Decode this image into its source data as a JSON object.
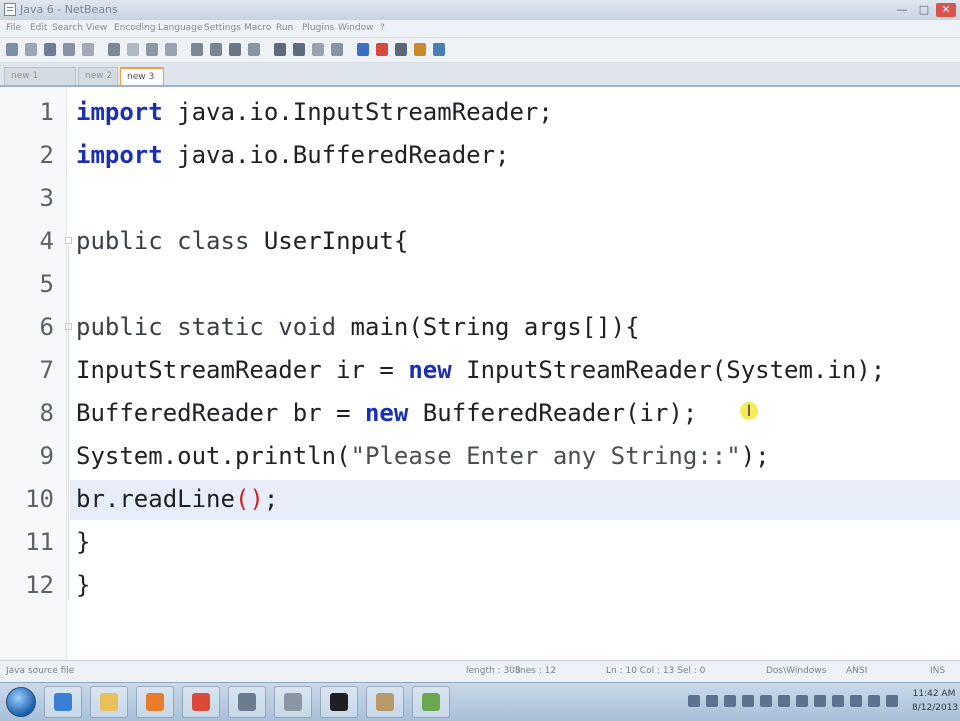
{
  "window": {
    "title": "Java 6 - NetBeans",
    "controls": {
      "minimize": "—",
      "maximize": "□",
      "close": "✕"
    }
  },
  "menu": {
    "items": [
      "File",
      "Edit",
      "Search",
      "View",
      "Encoding",
      "Language",
      "Settings",
      "Macro",
      "Run",
      "Plugins",
      "Window",
      "?"
    ]
  },
  "toolbar": {
    "icons": [
      "new-file-icon",
      "open-file-icon",
      "save-icon",
      "save-all-icon",
      "close-icon",
      "print-icon",
      "cut-icon",
      "copy-icon",
      "paste-icon",
      "undo-icon",
      "redo-icon",
      "find-icon",
      "replace-icon",
      "zoom-in-icon",
      "zoom-out-icon",
      "wrap-icon",
      "indent-icon",
      "bookmark-icon",
      "macro-record-icon",
      "macro-stop-icon",
      "macro-play-icon",
      "run-icon"
    ]
  },
  "tabs": [
    {
      "label": "new 1"
    },
    {
      "label": "new 2"
    },
    {
      "label": "new 3",
      "active": true
    }
  ],
  "editor": {
    "current_line": 10,
    "lines": [
      {
        "num": "1",
        "tokens": [
          {
            "t": "import",
            "c": "kw"
          },
          {
            "t": " java.io.InputStreamReader;"
          }
        ]
      },
      {
        "num": "2",
        "tokens": [
          {
            "t": "import",
            "c": "kw"
          },
          {
            "t": " java.io.BufferedReader;"
          }
        ]
      },
      {
        "num": "3",
        "tokens": []
      },
      {
        "num": "4",
        "tokens": [
          {
            "t": "public class",
            "c": "ty"
          },
          {
            "t": " UserInput{"
          }
        ]
      },
      {
        "num": "5",
        "tokens": []
      },
      {
        "num": "6",
        "tokens": [
          {
            "t": "public static void",
            "c": "ty"
          },
          {
            "t": " main(String args[]){"
          }
        ]
      },
      {
        "num": "7",
        "tokens": [
          {
            "t": "InputStreamReader ir = "
          },
          {
            "t": "new",
            "c": "kw"
          },
          {
            "t": " InputStreamReader(System.in);"
          }
        ]
      },
      {
        "num": "8",
        "tokens": [
          {
            "t": "BufferedReader br = "
          },
          {
            "t": "new",
            "c": "kw"
          },
          {
            "t": " BufferedReader(ir);"
          }
        ]
      },
      {
        "num": "9",
        "tokens": [
          {
            "t": "System.out.println("
          },
          {
            "t": "\"Please Enter any String::\"",
            "c": "str"
          },
          {
            "t": ");"
          }
        ]
      },
      {
        "num": "10",
        "tokens": [
          {
            "t": "br.readLine"
          },
          {
            "t": "()",
            "c": "paren-hl"
          },
          {
            "t": ";"
          }
        ]
      },
      {
        "num": "11",
        "tokens": [
          {
            "t": "}"
          }
        ]
      },
      {
        "num": "12",
        "tokens": [
          {
            "t": "}"
          }
        ]
      }
    ],
    "cursor_glyph": "I"
  },
  "status": {
    "file_type": "Java source file",
    "length": "length : 308",
    "lines": "lines : 12",
    "position": "Ln : 10   Col : 13   Sel : 0",
    "eol": "Dos\\Windows",
    "encoding": "ANSI",
    "mode": "INS"
  },
  "taskbar": {
    "apps": [
      "internet-explorer-icon",
      "file-explorer-icon",
      "media-player-icon",
      "chrome-icon",
      "app-icon",
      "notepad-icon",
      "terminal-icon",
      "hourglass-icon",
      "paint-icon"
    ],
    "colors": [
      "#3b7fd4",
      "#e9c15a",
      "#e87c2a",
      "#d94a3a",
      "#6a7c8e",
      "#8a96a3",
      "#1d1f24",
      "#b89a6a",
      "#6aa84f"
    ],
    "clock_time": "11:42 AM",
    "clock_date": "8/12/2013"
  }
}
